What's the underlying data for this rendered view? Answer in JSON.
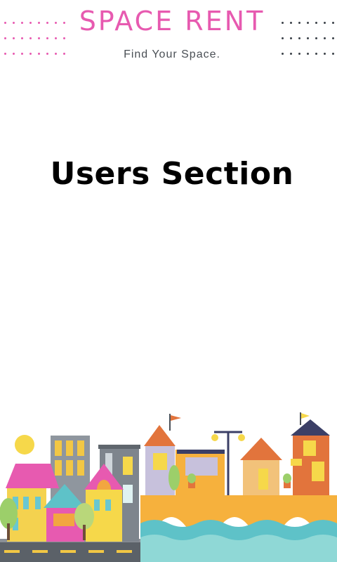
{
  "brand": {
    "title": "SPACE RENT",
    "tagline": "Find Your Space."
  },
  "main": {
    "section_title": "Users Section"
  },
  "illustration": {
    "name": "city-street-illustration"
  },
  "colors": {
    "brand_pink": "#e75ab0",
    "dot_dark": "#3b4148",
    "text_dark": "#000000",
    "tagline_gray": "#4a4f55"
  }
}
